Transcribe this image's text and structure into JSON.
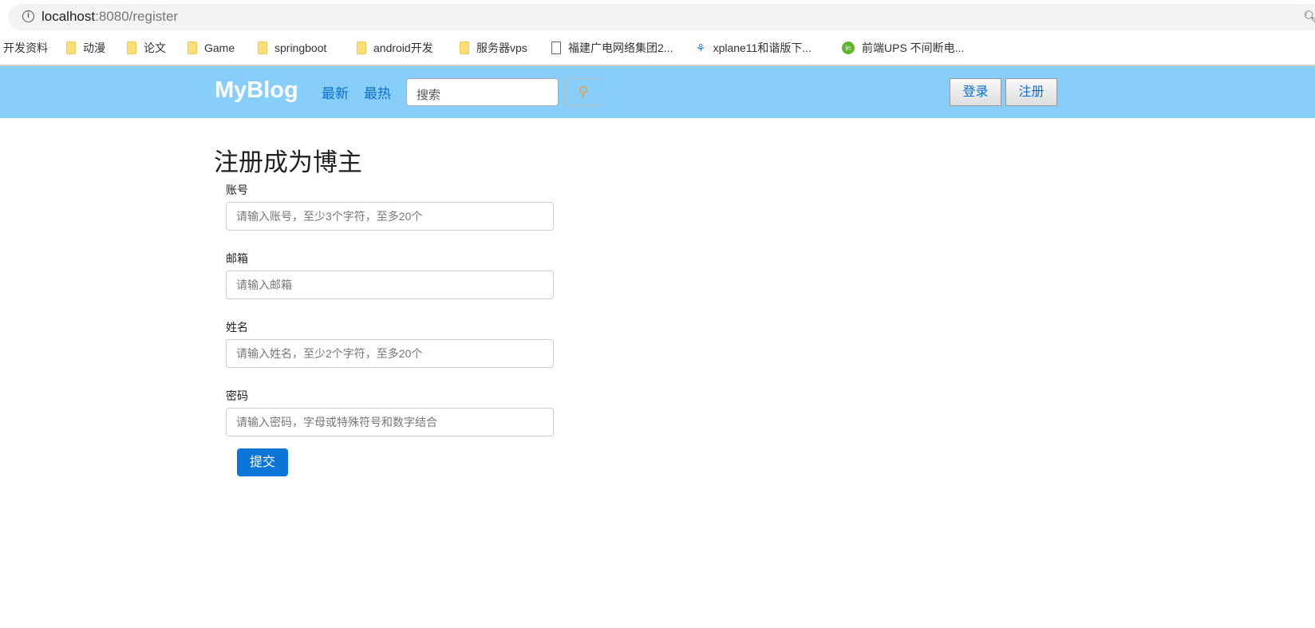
{
  "browser": {
    "url_host": "localhost",
    "url_rest": ":8080/register"
  },
  "bookmarks": [
    {
      "label": "开发资料",
      "icon": "none"
    },
    {
      "label": "动漫",
      "icon": "folder"
    },
    {
      "label": "论文",
      "icon": "folder"
    },
    {
      "label": "Game",
      "icon": "folder"
    },
    {
      "label": "springboot",
      "icon": "folder"
    },
    {
      "label": "android开发",
      "icon": "folder"
    },
    {
      "label": "服务器vps",
      "icon": "folder"
    },
    {
      "label": "福建广电网络集团2...",
      "icon": "page"
    },
    {
      "label": "xplane11和谐版下...",
      "icon": "baidu-paw"
    },
    {
      "label": "前端UPS 不间断电...",
      "icon": "leaf"
    }
  ],
  "navbar": {
    "brand": "MyBlog",
    "latest": "最新",
    "hot": "最热",
    "search_placeholder": "搜索",
    "login": "登录",
    "register": "注册"
  },
  "form": {
    "title": "注册成为博主",
    "fields": [
      {
        "label": "账号",
        "placeholder": "请输入账号，至少3个字符，至多20个"
      },
      {
        "label": "邮箱",
        "placeholder": "请输入邮箱"
      },
      {
        "label": "姓名",
        "placeholder": "请输入姓名，至少2个字符，至多20个"
      },
      {
        "label": "密码",
        "placeholder": "请输入密码，字母或特殊符号和数字结合"
      }
    ],
    "submit": "提交"
  }
}
